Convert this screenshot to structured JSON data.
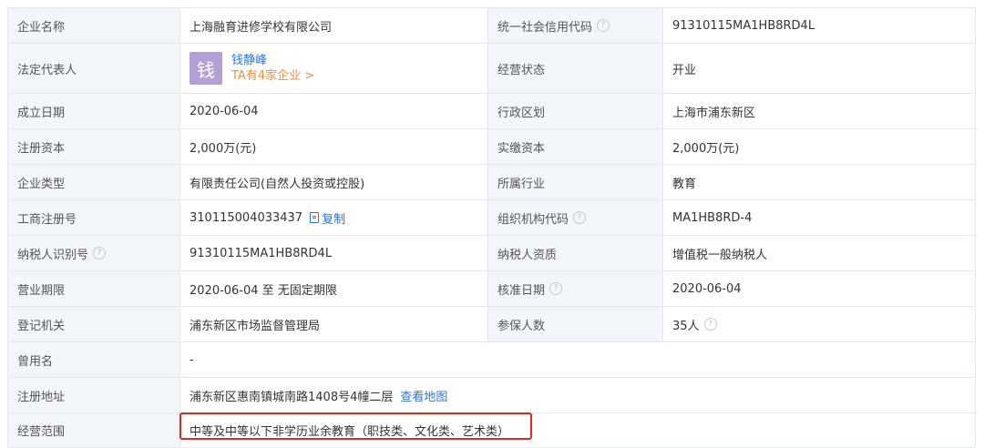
{
  "rows": [
    {
      "l1": "企业名称",
      "v1": "上海融育进修学校有限公司",
      "l2": "统一社会信用代码",
      "v2": "91310115MA1HB8RD4L"
    },
    {
      "l1": "法定代表人",
      "rep_avatar": "钱",
      "rep_name": "钱静峰",
      "rep_link": "TA有4家企业 >",
      "l2": "经营状态",
      "v2": "开业"
    },
    {
      "l1": "成立日期",
      "v1": "2020-06-04",
      "l2": "行政区划",
      "v2": "上海市浦东新区"
    },
    {
      "l1": "注册资本",
      "v1": "2,000万(元)",
      "l2": "实缴资本",
      "v2": "2,000万(元)"
    },
    {
      "l1": "企业类型",
      "v1": "有限责任公司(自然人投资或控股)",
      "l2": "所属行业",
      "v2": "教育"
    },
    {
      "l1": "工商注册号",
      "v1": "310115004033437",
      "copy": "复制",
      "l2": "组织机构代码",
      "v2": "MA1HB8RD-4"
    },
    {
      "l1": "纳税人识别号",
      "v1": "91310115MA1HB8RD4L",
      "l2": "纳税人资质",
      "v2": "增值税一般纳税人"
    },
    {
      "l1": "营业期限",
      "v1": "2020-06-04 至 无固定期限",
      "l2": "核准日期",
      "v2": "2020-06-04"
    },
    {
      "l1": "登记机关",
      "v1": "浦东新区市场监督管理局",
      "l2": "参保人数",
      "v2": "35人"
    },
    {
      "l1": "曾用名",
      "v1": "-"
    },
    {
      "l1": "注册地址",
      "v1": "浦东新区惠南镇城南路1408号4幢二层",
      "map": "查看地图"
    },
    {
      "l1": "经营范围",
      "v1": "中等及中等以下非学历业余教育（职技类、文化类、艺术类）"
    }
  ],
  "help_glyph": "?",
  "icons": {
    "help": "question-circle-icon",
    "copy": "copy-icon"
  },
  "colors": {
    "label_bg": "#f2f5fa",
    "border": "#e4e8ee",
    "link": "#2b74e0",
    "orange": "#f08e43",
    "avatar_bg": "#b3a1d6",
    "highlight": "#e8251f"
  }
}
